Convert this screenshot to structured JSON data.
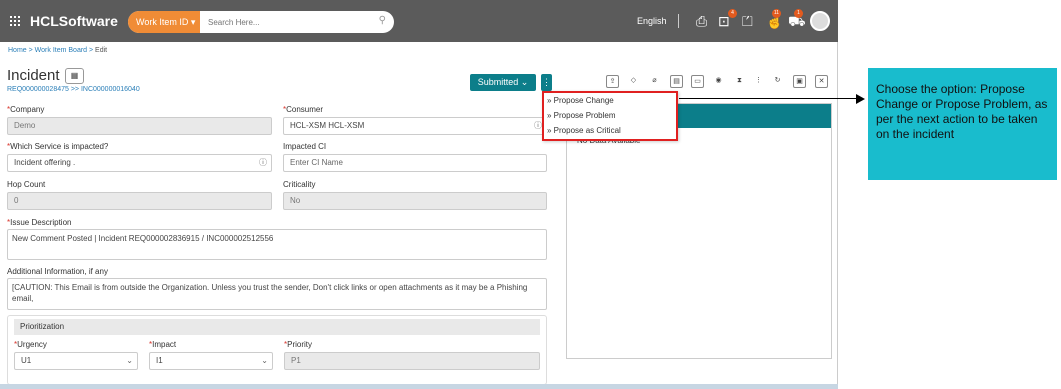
{
  "topbar": {
    "brand": "HCLSoftware",
    "search_type": "Work Item ID",
    "search_placeholder": "Search Here...",
    "language": "English",
    "badges": [
      "4",
      "11",
      "1"
    ]
  },
  "breadcrumb": {
    "home": "Home",
    "board": "Work Item Board",
    "current": "Edit"
  },
  "header": {
    "title": "Incident",
    "refs": "REQ000000028475 >> INC000000016040",
    "status": "Submitted"
  },
  "dropdown": {
    "items": [
      "» Propose Change",
      "» Propose Problem",
      "» Propose as Critical"
    ]
  },
  "form": {
    "company_label": "Company",
    "company_value": "Demo",
    "consumer_label": "Consumer",
    "consumer_value": "HCL-XSM HCL-XSM",
    "service_label": "Which Service is impacted?",
    "service_value": "Incident offering .",
    "ci_label": "Impacted CI",
    "ci_placeholder": "Enter CI Name",
    "hop_label": "Hop Count",
    "hop_value": "0",
    "criticality_label": "Criticality",
    "criticality_value": "No",
    "issue_label": "Issue Description",
    "issue_value": "New Comment Posted | Incident REQ000002836915 / INC000002512556",
    "addl_label": "Additional Information, if any",
    "addl_value": "[CAUTION: This Email is from outside the Organization. Unless you trust the sender, Don't click links or open attachments as it may be a Phishing email,"
  },
  "prioritization": {
    "heading": "Prioritization",
    "urgency_label": "Urgency",
    "urgency_value": "U1",
    "impact_label": "Impact",
    "impact_value": "I1",
    "priority_label": "Priority",
    "priority_value": "P1"
  },
  "right_panel": {
    "no_data": "No Data Available"
  },
  "callout": {
    "text": "Choose the option: Propose Change or Propose Problem, as per the next action to be taken on the incident"
  },
  "colors": {
    "teal": "#0c7e8a",
    "orange": "#f08c36",
    "callout": "#19bccd",
    "highlight": "#e02020"
  }
}
